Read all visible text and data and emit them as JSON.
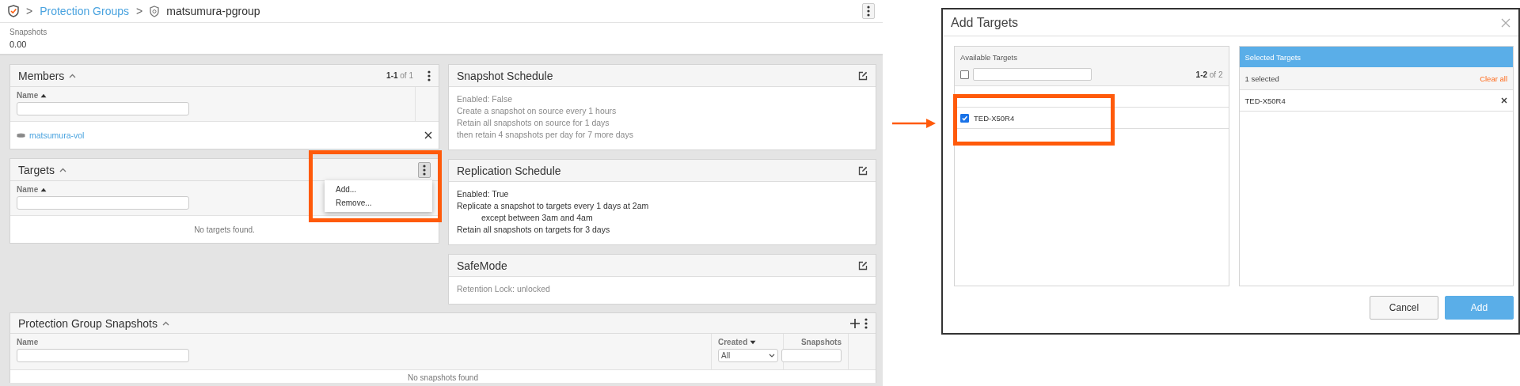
{
  "breadcrumb": {
    "separator_1": ">",
    "link": "Protection Groups",
    "separator_2": ">",
    "current": "matsumura-pgroup"
  },
  "summary": {
    "label": "Snapshots",
    "value": "0.00"
  },
  "members": {
    "title": "Members",
    "range": "1-1",
    "total": "of 1",
    "column": {
      "label": "Name",
      "sorted": true,
      "descending": false
    },
    "rows": [
      {
        "name": "matsumura-vol"
      }
    ]
  },
  "targets": {
    "title": "Targets",
    "column": {
      "label": "Name",
      "sorted": true,
      "descending": false
    },
    "empty": "No targets found.",
    "menu_open": true,
    "menu": [
      "Add...",
      "Remove..."
    ]
  },
  "schedules": [
    {
      "title": "Snapshot Schedule",
      "muted": true,
      "lines": [
        {
          "text": "Enabled: False",
          "indented": false
        },
        {
          "text": "Create a snapshot on source every 1 hours",
          "indented": false
        },
        {
          "text": "Retain all snapshots on source for 1 days",
          "indented": false
        },
        {
          "text": "then retain 4 snapshots per day for 7 more days",
          "indented": false
        }
      ]
    },
    {
      "title": "Replication Schedule",
      "muted": false,
      "lines": [
        {
          "text": "Enabled: True",
          "indented": false
        },
        {
          "text": "Replicate a snapshot to targets every 1 days at 2am",
          "indented": false
        },
        {
          "text": "except between 3am and 4am",
          "indented": true
        },
        {
          "text": "Retain all snapshots on targets for 3 days",
          "indented": false
        }
      ]
    },
    {
      "title": "SafeMode",
      "muted": true,
      "lines": [
        {
          "text": "Retention Lock: unlocked",
          "indented": false
        }
      ]
    }
  ],
  "pg_snapshots": {
    "title": "Protection Group Snapshots",
    "columns": [
      {
        "label": "Name",
        "sorted": false,
        "kind": "text"
      },
      {
        "label": "Created",
        "sorted": true,
        "descending": true,
        "kind": "select",
        "value": "All"
      },
      {
        "label": "Snapshots",
        "sorted": false,
        "kind": "text"
      }
    ],
    "empty": "No snapshots found"
  },
  "dialog": {
    "title": "Add Targets",
    "available": {
      "title": "Available Targets",
      "select_all": false,
      "range": "1-2",
      "total": "of 2",
      "items": [
        {
          "label": "TED-X50R4",
          "checked": true
        }
      ]
    },
    "selected": {
      "title": "Selected Targets",
      "count": "1 selected",
      "clear": "Clear all",
      "items": [
        "TED-X50R4"
      ]
    },
    "buttons": [
      {
        "label": "Cancel",
        "kind": "secondary"
      },
      {
        "label": "Add",
        "kind": "primary"
      }
    ]
  }
}
